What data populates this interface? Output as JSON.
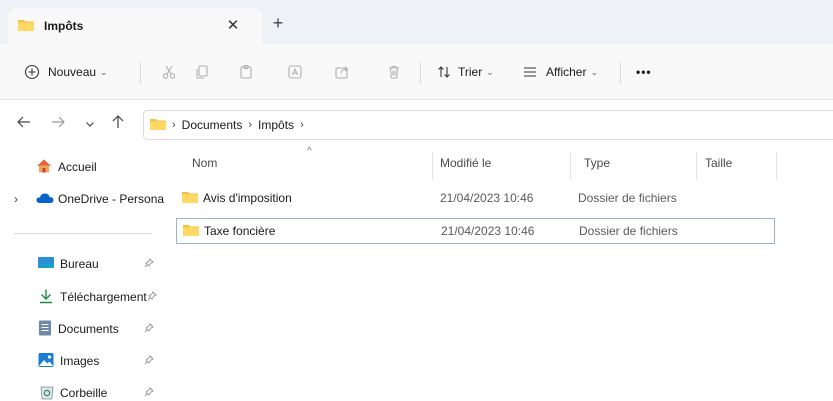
{
  "window": {
    "tab_title": "Impôts",
    "tab_close": "✕",
    "new_tab": "+"
  },
  "toolbar": {
    "new_label": "Nouveau",
    "sort_label": "Trier",
    "view_label": "Afficher",
    "more_label": "•••",
    "chevron": "⌄"
  },
  "address": {
    "crumbs": [
      "Documents",
      "Impôts"
    ],
    "separator": "›"
  },
  "sidebar": {
    "items": [
      {
        "label": "Accueil",
        "icon": "home-icon"
      },
      {
        "label": "OneDrive - Persona",
        "icon": "cloud-icon"
      },
      {
        "label": "Bureau",
        "icon": "desktop-icon"
      },
      {
        "label": "Téléchargement",
        "icon": "download-icon"
      },
      {
        "label": "Documents",
        "icon": "document-icon"
      },
      {
        "label": "Images",
        "icon": "image-icon"
      },
      {
        "label": "Corbeille",
        "icon": "recycle-bin-icon"
      }
    ],
    "expand_glyph": "›",
    "pin_glyph": "📌"
  },
  "list": {
    "columns": [
      "Nom",
      "Modifié le",
      "Type",
      "Taille"
    ],
    "sort_glyph": "^",
    "rows": [
      {
        "name": "Avis d'imposition",
        "modified": "21/04/2023 10:46",
        "type": "Dossier de fichiers",
        "size": ""
      },
      {
        "name": "Taxe foncière",
        "modified": "21/04/2023 10:46",
        "type": "Dossier de fichiers",
        "size": ""
      }
    ]
  },
  "colors": {
    "folder": "#f5c342",
    "accent": "#0067c0",
    "selection_border": "#9ab3d3",
    "tabstrip_bg": "#eef1f6"
  }
}
